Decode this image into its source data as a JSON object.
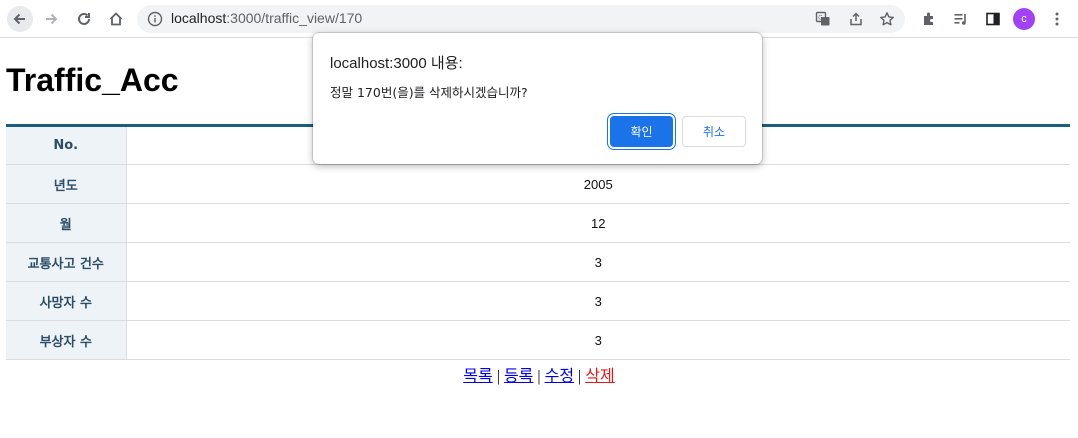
{
  "browser": {
    "url_host": "localhost",
    "url_rest": ":3000/traffic_view/170",
    "profile_initial": "c"
  },
  "page": {
    "title": "Traffic_Acc",
    "rows": [
      {
        "label": "No.",
        "value": ""
      },
      {
        "label": "년도",
        "value": "2005"
      },
      {
        "label": "월",
        "value": "12"
      },
      {
        "label": "교통사고 건수",
        "value": "3"
      },
      {
        "label": "사망자 수",
        "value": "3"
      },
      {
        "label": "부상자 수",
        "value": "3"
      }
    ],
    "links": {
      "list": "목록",
      "register": "등록",
      "edit": "수정",
      "delete": "삭제",
      "separator": "|"
    }
  },
  "dialog": {
    "title": "localhost:3000 내용:",
    "message": "정말 170번(을)를 삭제하시겠습니까?",
    "ok_label": "확인",
    "cancel_label": "취소"
  },
  "colors": {
    "accent": "#1a73e8",
    "table_border": "#1b5f7e",
    "delete_link": "#e0191b"
  }
}
